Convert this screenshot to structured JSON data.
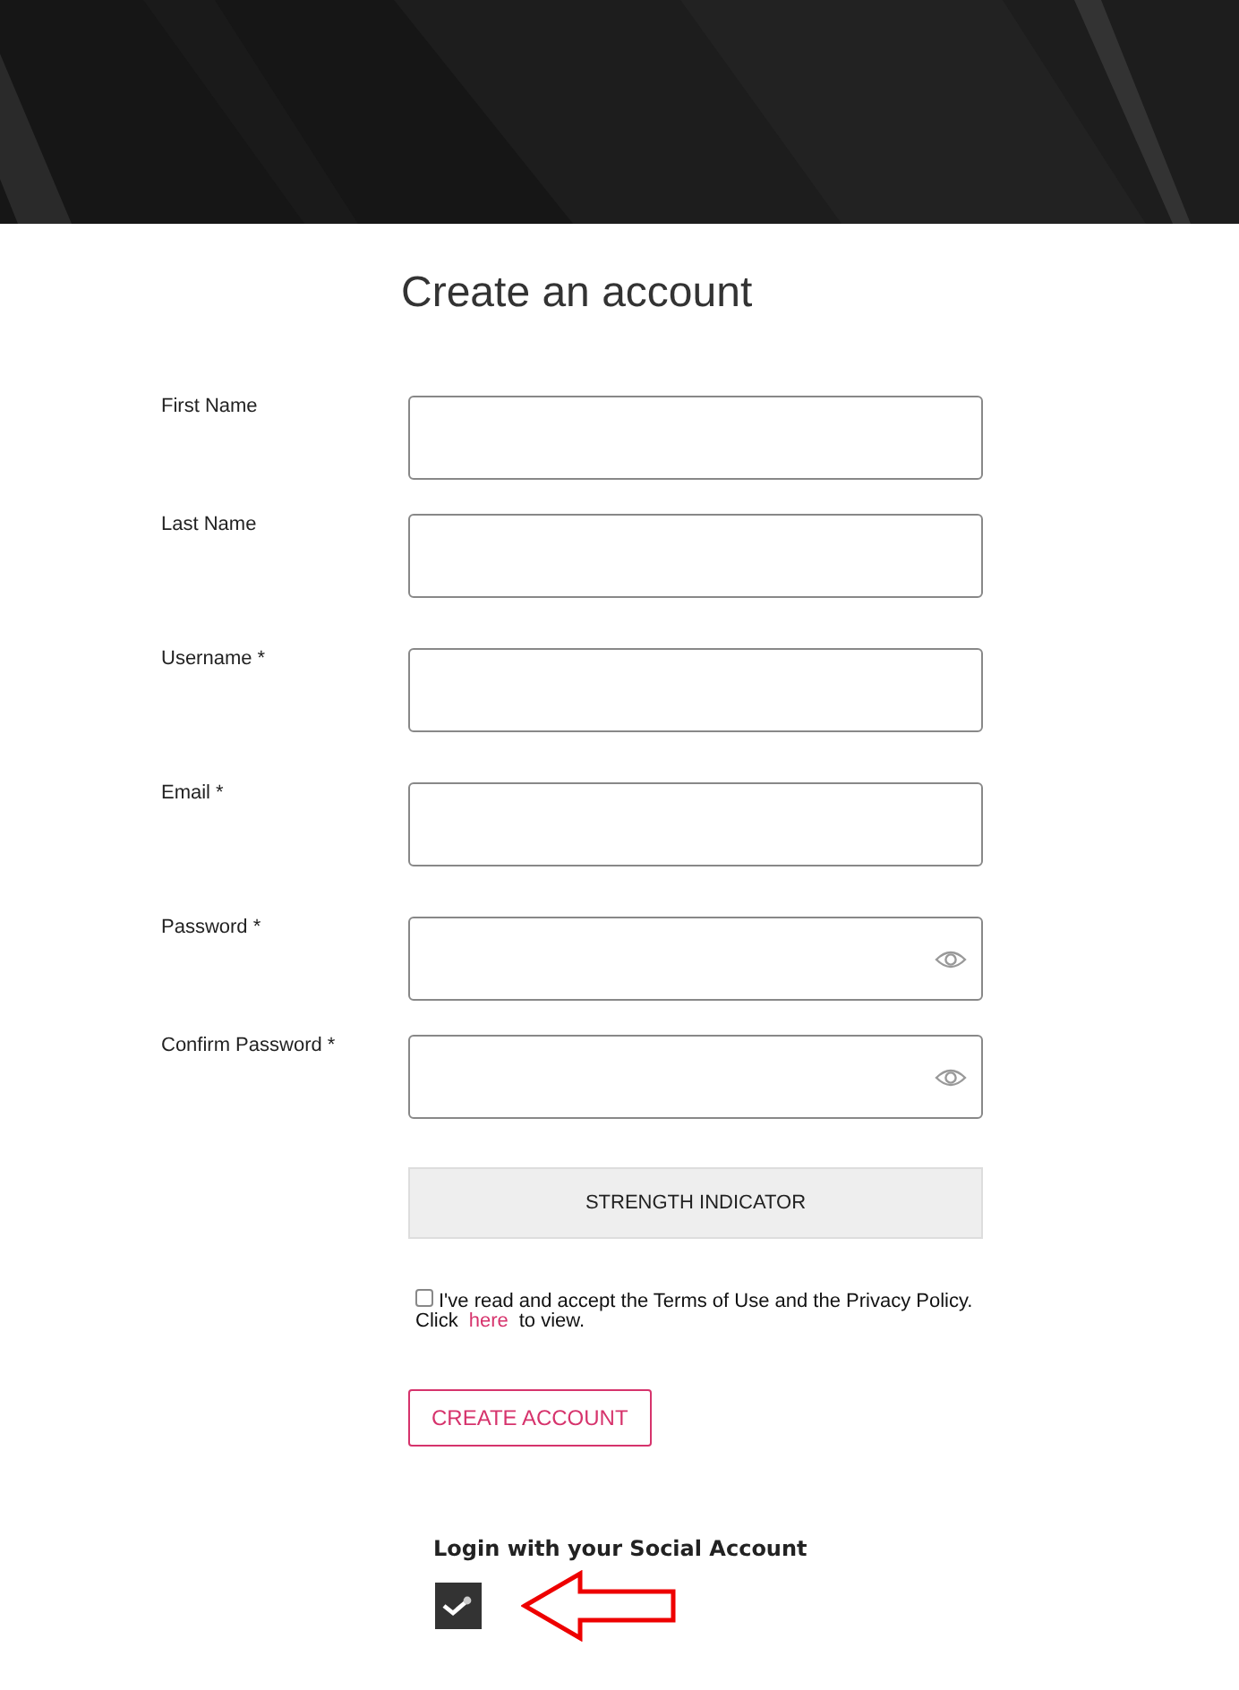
{
  "title": "Create an account",
  "fields": [
    {
      "label": "First Name",
      "kind": "text"
    },
    {
      "label": "Last Name",
      "kind": "text"
    },
    {
      "label": "Username *",
      "kind": "text"
    },
    {
      "label": "Email *",
      "kind": "text"
    },
    {
      "label": "Password *",
      "kind": "password"
    },
    {
      "label": "Confirm Password *",
      "kind": "password"
    }
  ],
  "strength_indicator": "STRENGTH INDICATOR",
  "terms": {
    "checked": false,
    "text": "I've read and accept the Terms of Use and the Privacy Policy.",
    "click": "Click",
    "link": "here",
    "after": "to view."
  },
  "submit": "CREATE ACCOUNT",
  "social": {
    "heading": "Login with your Social Account"
  }
}
